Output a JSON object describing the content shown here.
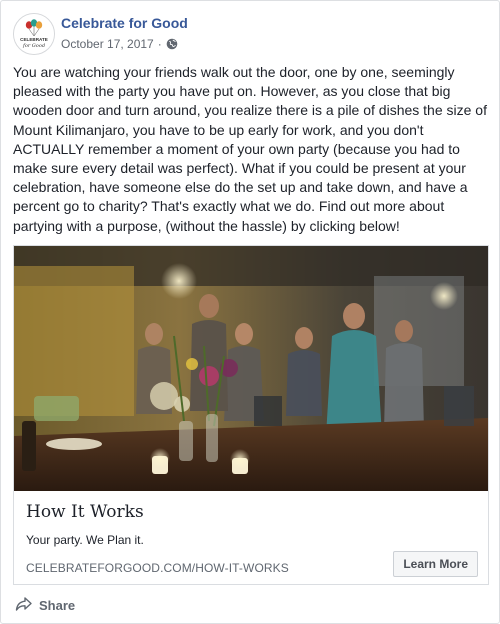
{
  "post": {
    "page_name": "Celebrate for Good",
    "date": "October 17, 2017",
    "date_separator": "·",
    "privacy_icon": "globe-icon",
    "avatar": {
      "logo_text_1": "CELEBRATE",
      "logo_text_2": "for Good"
    },
    "body": "You are watching your friends walk out the door, one by one, seemingly pleased with the party you have put on. However, as you close that big wooden door and turn around, you realize there is a pile of dishes the size of Mount Kilimanjaro, you have to be up early for work, and you don't ACTUALLY remember a moment of your own party (because you had to make sure every detail was perfect). What if you could be present at your celebration, have someone else do the set up and take down, and have a percent go to charity? That's exactly what we do. Find out more about partying with a purpose, (without the hassle) by clicking below!"
  },
  "link": {
    "title": "How It Works",
    "description": "Your party. We Plan it.",
    "domain": "CELEBRATEFORGOOD.COM/HOW-IT-WORKS",
    "cta": "Learn More"
  },
  "actions": {
    "share_label": "Share",
    "share_icon": "share-arrow-icon"
  },
  "colors": {
    "link_blue": "#385898",
    "meta_gray": "#616770",
    "border": "#dddfe2",
    "logo_red": "#c9302c",
    "logo_teal": "#2a9d8f"
  }
}
